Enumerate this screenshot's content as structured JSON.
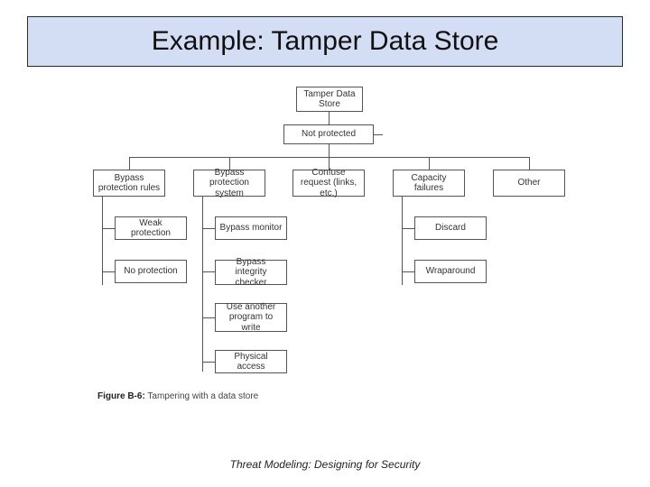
{
  "title": "Example: Tamper Data Store",
  "footer": "Threat Modeling: Designing for Security",
  "caption": {
    "fignum": "Figure B-6:",
    "text": " Tampering with a data store"
  },
  "nodes": {
    "root": "Tamper Data Store",
    "not_protected": "Not protected",
    "c1": "Bypass protection rules",
    "c2": "Bypass protection system",
    "c3": "Confuse request (links, etc.)",
    "c4": "Capacity failures",
    "c5": "Other",
    "c1a": "Weak protection",
    "c1b": "No protection",
    "c2a": "Bypass monitor",
    "c2b": "Bypass integrity checker",
    "c2c": "Use another program to write",
    "c2d": "Physical access",
    "c4a": "Discard",
    "c4b": "Wraparound"
  }
}
